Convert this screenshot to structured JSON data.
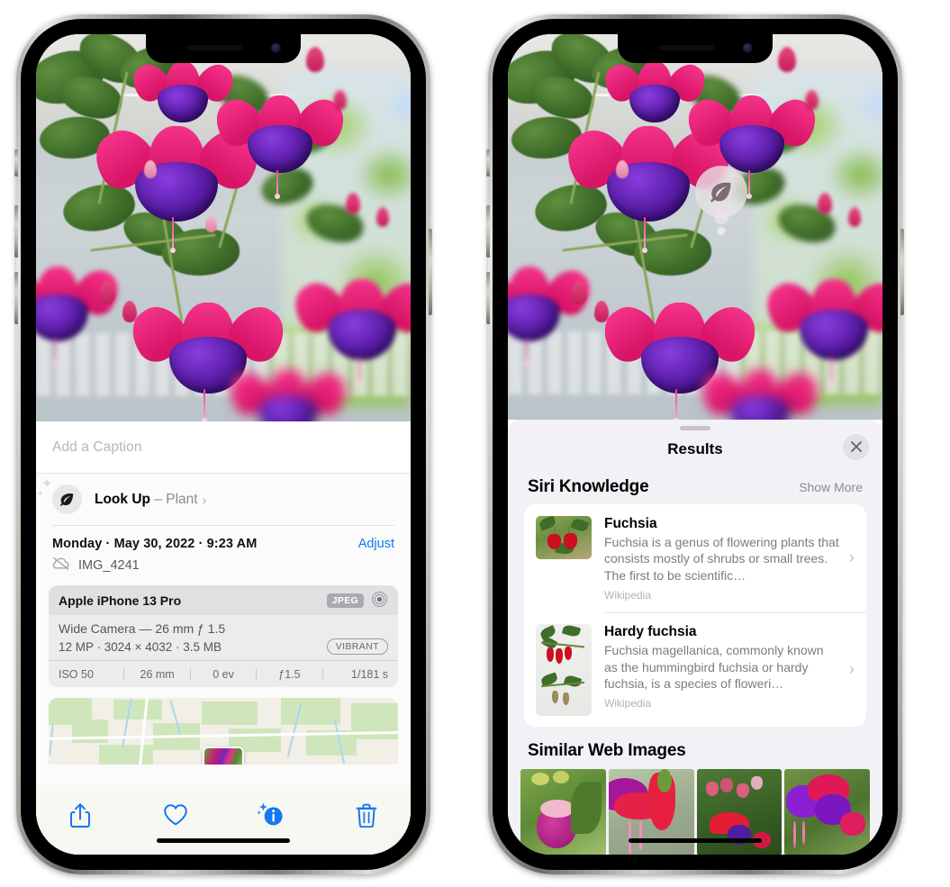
{
  "left_phone": {
    "caption": {
      "placeholder": "Add a Caption",
      "value": ""
    },
    "look_up": {
      "icon": "leaf-icon",
      "label": "Look Up",
      "dash": "–",
      "subject": "Plant",
      "chevron": "›"
    },
    "date_row": {
      "date_text": "Monday · May 30, 2022 · 9:23 AM",
      "adjust_label": "Adjust",
      "cloud_icon": "cloud-slash-icon",
      "file_name": "IMG_4241"
    },
    "metadata": {
      "device": "Apple iPhone 13 Pro",
      "format_badge": "JPEG",
      "aperture_icon": "camera-aperture-icon",
      "lens_line": "Wide Camera — 26 mm ƒ 1.5",
      "size_line": "12 MP · 3024 × 4032 · 3.5 MB",
      "style_badge": "VIBRANT",
      "exif": [
        "ISO 50",
        "26 mm",
        "0 ev",
        "ƒ1.5",
        "1/181 s"
      ]
    },
    "map": {
      "pin_icon": "photo-pin"
    },
    "toolbar": [
      {
        "name": "share-button",
        "icon": "share-icon"
      },
      {
        "name": "favorite-button",
        "icon": "heart-icon"
      },
      {
        "name": "info-button",
        "icon": "info-sparkle-icon"
      },
      {
        "name": "delete-button",
        "icon": "trash-icon"
      }
    ],
    "accent_color": "#1478f0"
  },
  "right_phone": {
    "badge": {
      "icon": "leaf-icon",
      "name": "visual-lookup-badge"
    },
    "sheet": {
      "title": "Results",
      "close_icon": "close-icon",
      "sections": [
        {
          "title": "Siri Knowledge",
          "action": "Show More",
          "items": [
            {
              "title": "Fuchsia",
              "description": "Fuchsia is a genus of flowering plants that consists mostly of shrubs or small trees. The first to be scientific…",
              "source": "Wikipedia",
              "chevron": "›"
            },
            {
              "title": "Hardy fuchsia",
              "description": "Fuchsia magellanica, commonly known as the hummingbird fuchsia or hardy fuchsia, is a species of floweri…",
              "source": "Wikipedia",
              "chevron": "›"
            }
          ]
        },
        {
          "title": "Similar Web Images",
          "thumb_count": 4
        }
      ]
    }
  }
}
